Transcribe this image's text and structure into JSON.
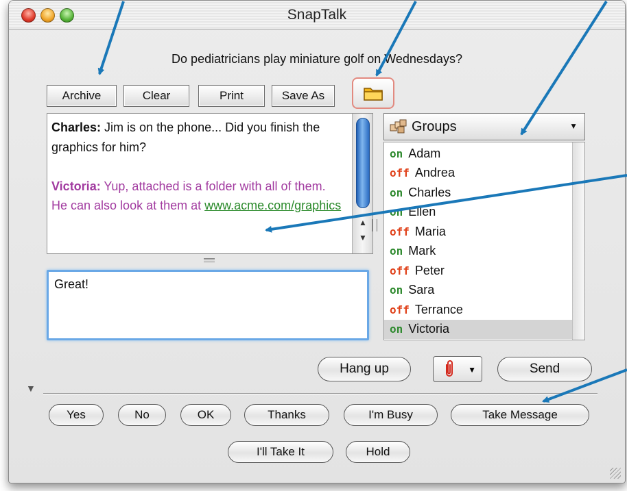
{
  "window": {
    "title": "SnapTalk"
  },
  "status": {
    "question": "Do pediatricians play miniature golf on Wednesdays?"
  },
  "toolbar": {
    "archive_label": "Archive",
    "clear_label": "Clear",
    "print_label": "Print",
    "save_as_label": "Save As",
    "folder_icon": "folder-icon"
  },
  "transcript": {
    "messages": [
      {
        "speaker": "Charles:",
        "text": "Jim is on the phone... Did you finish the graphics for him?"
      },
      {
        "speaker": "Victoria:",
        "text": "Yup, attached is a folder with all of them. He can also look at them at",
        "link": "www.acme.com/graphics"
      }
    ]
  },
  "compose": {
    "value": "Great!"
  },
  "groups": {
    "label": "Groups",
    "icon": "groups-icon",
    "buddies": [
      {
        "status": "on",
        "name": "Adam"
      },
      {
        "status": "off",
        "name": "Andrea"
      },
      {
        "status": "on",
        "name": "Charles"
      },
      {
        "status": "on",
        "name": "Ellen"
      },
      {
        "status": "off",
        "name": "Maria"
      },
      {
        "status": "on",
        "name": "Mark"
      },
      {
        "status": "off",
        "name": "Peter"
      },
      {
        "status": "on",
        "name": "Sara"
      },
      {
        "status": "off",
        "name": "Terrance"
      },
      {
        "status": "on",
        "name": "Victoria"
      }
    ],
    "selected": "Victoria"
  },
  "actions": {
    "hang_up_label": "Hang up",
    "send_label": "Send",
    "attach_icon": "paperclip-icon"
  },
  "quick_replies": {
    "row1": [
      "Yes",
      "No",
      "OK",
      "Thanks",
      "I'm Busy",
      "Take Message"
    ],
    "row2": [
      "I'll Take It",
      "Hold"
    ]
  },
  "colors": {
    "online": "#2f8a2f",
    "offline": "#e0421b",
    "victoria_text": "#a23ba0",
    "link": "#2b8a2b",
    "callout_arrow": "#1a78b8",
    "focus_ring": "#6aa8e6"
  }
}
